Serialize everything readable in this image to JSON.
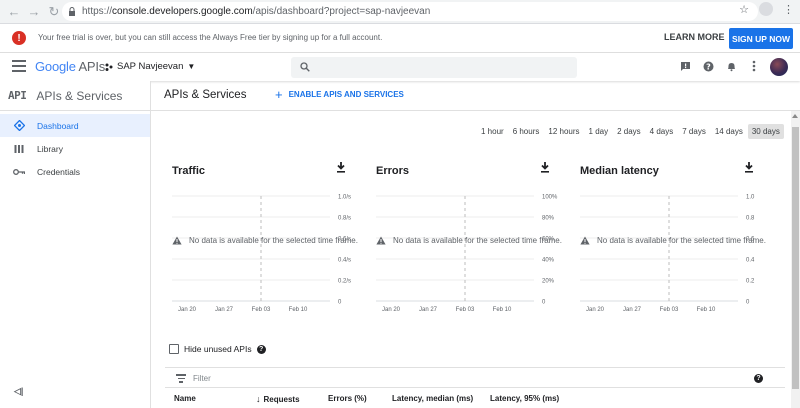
{
  "browser": {
    "url_prefix": "https://",
    "url_host": "console.developers.google.com",
    "url_path": "/apis/dashboard?project=sap-navjeevan"
  },
  "banner": {
    "message": "Your free trial is over, but you can still access the Always Free tier by signing up for a full account.",
    "learn_more": "LEARN MORE",
    "sign_up": "SIGN UP NOW"
  },
  "header": {
    "logo_google": "Google",
    "logo_apis": "APIs",
    "project": "SAP Navjeevan"
  },
  "sidebar": {
    "mark": "API",
    "title": "APIs & Services",
    "items": [
      {
        "label": "Dashboard",
        "icon": "dashboard-icon",
        "active": true
      },
      {
        "label": "Library",
        "icon": "library-icon",
        "active": false
      },
      {
        "label": "Credentials",
        "icon": "key-icon",
        "active": false
      }
    ],
    "collapse": "◁|"
  },
  "main": {
    "title": "APIs & Services",
    "enable_label": "ENABLE APIS AND SERVICES",
    "time_ranges": [
      "1 hour",
      "6 hours",
      "12 hours",
      "1 day",
      "2 days",
      "4 days",
      "7 days",
      "14 days",
      "30 days"
    ],
    "selected_range": "30 days",
    "no_data": "No data is available for the selected time frame.",
    "hide_unused": "Hide unused APIs",
    "filter_placeholder": "Filter",
    "table_headers": [
      "Name",
      "Requests",
      "Errors (%)",
      "Latency, median (ms)",
      "Latency, 95% (ms)"
    ]
  },
  "chart_data": [
    {
      "type": "line",
      "title": "Traffic",
      "x_ticks": [
        "Jan 20",
        "Jan 27",
        "Feb 03",
        "Feb 10"
      ],
      "y_ticks": [
        "0",
        "0.2/s",
        "0.4/s",
        "0.6/s",
        "0.8/s",
        "1.0/s"
      ],
      "ylim": [
        0,
        1.0
      ],
      "series": []
    },
    {
      "type": "line",
      "title": "Errors",
      "x_ticks": [
        "Jan 20",
        "Jan 27",
        "Feb 03",
        "Feb 10"
      ],
      "y_ticks": [
        "0",
        "20%",
        "40%",
        "60%",
        "80%",
        "100%"
      ],
      "ylim": [
        0,
        100
      ],
      "series": []
    },
    {
      "type": "line",
      "title": "Median latency",
      "x_ticks": [
        "Jan 20",
        "Jan 27",
        "Feb 03",
        "Feb 10"
      ],
      "y_ticks": [
        "0",
        "0.2",
        "0.4",
        "0.6",
        "0.8",
        "1.0"
      ],
      "ylim": [
        0,
        1.0
      ],
      "series": []
    }
  ]
}
